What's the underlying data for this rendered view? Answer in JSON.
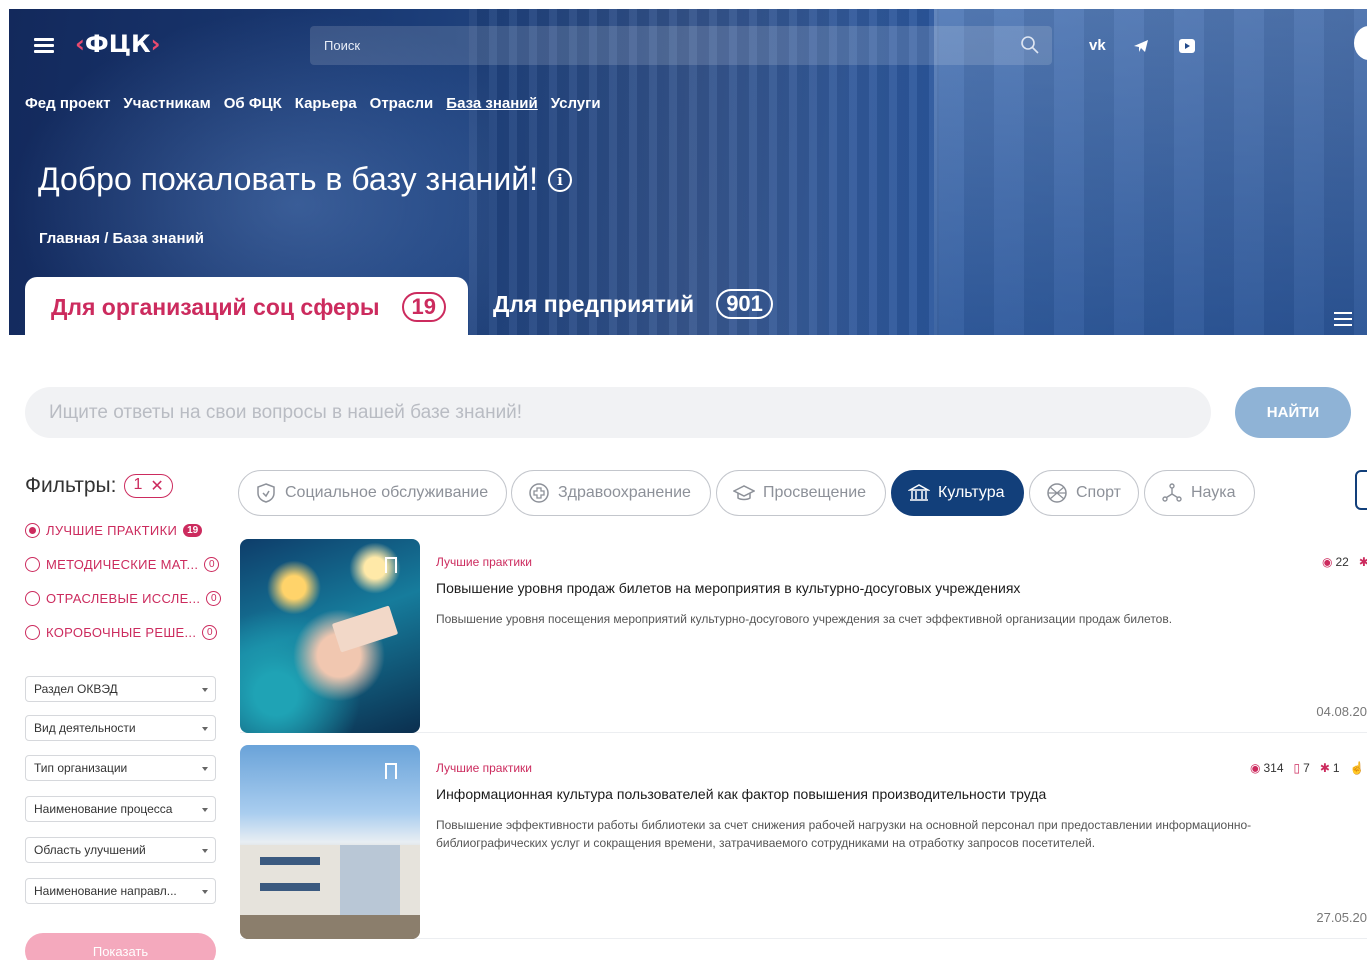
{
  "header": {
    "logo": "ФЦК",
    "search_placeholder": "Поиск",
    "social": [
      "VK",
      "Telegram",
      "YouTube"
    ],
    "nav": [
      "Фед проект",
      "Участникам",
      "Об ФЦК",
      "Карьера",
      "Отрасли",
      "База знаний",
      "Услуги"
    ],
    "active_nav": "База знаний",
    "title": "Добро пожаловать в базу знаний!",
    "breadcrumb": [
      "Главная",
      "База знаний"
    ],
    "tabs": [
      {
        "label": "Для организаций соц сферы",
        "count": "19"
      },
      {
        "label": "Для предприятий",
        "count": "901"
      }
    ]
  },
  "kb_search": {
    "placeholder": "Ищите ответы на свои вопросы в нашей базе знаний!",
    "button": "НАЙТИ"
  },
  "filters": {
    "title": "Фильтры:",
    "active_count": "1",
    "types": [
      {
        "label": "ЛУЧШИЕ ПРАКТИКИ",
        "count": "19",
        "selected": true
      },
      {
        "label": "МЕТОДИЧЕСКИЕ МАТ...",
        "count": "0",
        "selected": false
      },
      {
        "label": "ОТРАСЛЕВЫЕ ИССЛЕ...",
        "count": "0",
        "selected": false
      },
      {
        "label": "КОРОБОЧНЫЕ РЕШЕ...",
        "count": "0",
        "selected": false
      }
    ],
    "dropdowns": [
      "Раздел ОКВЭД",
      "Вид деятельности",
      "Тип организации",
      "Наименование процесса",
      "Область улучшений",
      "Наименование направл..."
    ],
    "show_button": "Показать"
  },
  "categories": [
    {
      "label": "Социальное обслуживание",
      "icon": "shield-icon",
      "active": false
    },
    {
      "label": "Здравоохранение",
      "icon": "medical-cross-icon",
      "active": false
    },
    {
      "label": "Просвещение",
      "icon": "graduation-cap-icon",
      "active": false
    },
    {
      "label": "Культура",
      "icon": "museum-icon",
      "active": true
    },
    {
      "label": "Спорт",
      "icon": "ball-icon",
      "active": false
    },
    {
      "label": "Наука",
      "icon": "molecule-icon",
      "active": false
    }
  ],
  "colors": {
    "accent": "#cc2b5e",
    "primary": "#123f7a",
    "find_button": "#8fb3d6"
  },
  "cards": [
    {
      "category": "Лучшие практики",
      "title": "Повышение уровня продаж билетов на мероприятия в культурно-досуговых учреждениях",
      "description": "Повышение уровня посещения мероприятий культурно-досугового учреждения за счет эффективной организации продаж билетов.",
      "views": "22",
      "date": "04.08.20"
    },
    {
      "category": "Лучшие практики",
      "title": "Информационная культура пользователей как фактор повышения производительности труда",
      "description": "Повышение эффективности работы библиотеки за счет снижения рабочей нагрузки на основной персонал при предоставлении информационно-библиографических услуг и сокращения времени, затрачиваемого сотрудниками на отработку запросов посетителей.",
      "views": "314",
      "bookmarks": "7",
      "applied": "1",
      "date": "27.05.20"
    }
  ]
}
